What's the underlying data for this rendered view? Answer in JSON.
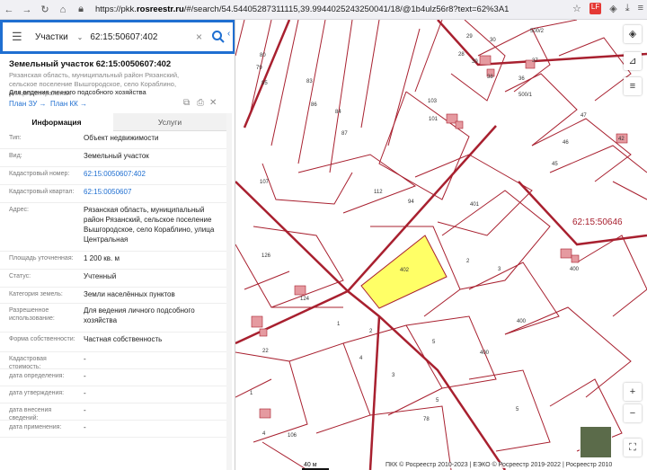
{
  "browser": {
    "url_prefix": "https://pkk.",
    "url_domain": "rosreestr.ru",
    "url_rest": "/#/search/54.54405287311115,39.9944025243250041/18/@1b4ulz56r8?text=62%3A1",
    "ext_badge": "LF"
  },
  "search": {
    "mode": "Участки",
    "query": "62:15:50607:402",
    "clear_symbol": "×"
  },
  "object": {
    "title": "Земельный участок 62:15:0050607:402",
    "address": "Рязанская область, муниципальный район Рязанский, сельское поселение Вышгородское, село Кораблино, улица Центральная",
    "purpose": "Для ведения личного подсобного хозяйства",
    "plan_zu": "План ЗУ →",
    "plan_kk": "План КК →"
  },
  "tabs": [
    "Информация",
    "Услуги"
  ],
  "rows": [
    {
      "k": "Тип:",
      "v": "Объект недвижимости"
    },
    {
      "k": "Вид:",
      "v": "Земельный участок"
    },
    {
      "k": "Кадастровый номер:",
      "v": "62:15:0050607:402"
    },
    {
      "k": "Кадастровый квартал:",
      "v": "62:15:0050607"
    },
    {
      "k": "Адрес:",
      "v": "Рязанская область, муниципальный район Рязанский, сельское поселение Вышгородское, село Кораблино, улица Центральная"
    },
    {
      "k": "Площадь уточненная:",
      "v": "1 200 кв. м"
    },
    {
      "k": "Статус:",
      "v": "Учтенный"
    },
    {
      "k": "Категория земель:",
      "v": "Земли населённых пунктов"
    },
    {
      "k": "Разрешенное использование:",
      "v": "Для ведения личного подсобного хозяйства"
    },
    {
      "k": "Форма собственности:",
      "v": "Частная собственность"
    },
    {
      "k": "Кадастровая стоимость:",
      "v": "-"
    },
    {
      "k": "дата определения:",
      "v": "-"
    },
    {
      "k": "дата утверждения:",
      "v": "-"
    },
    {
      "k": "дата внесения сведений:",
      "v": "-"
    },
    {
      "k": "дата применения:",
      "v": "-"
    }
  ],
  "map": {
    "labels": [
      "29",
      "28",
      "30",
      "500/2",
      "39",
      "38",
      "36",
      "37",
      "500/1",
      "80",
      "79",
      "85",
      "83",
      "86",
      "84",
      "103",
      "87",
      "101",
      "47",
      "46",
      "45",
      "42",
      "107",
      "112",
      "94",
      "401",
      "126",
      "402",
      "2",
      "3",
      "400",
      "124",
      "400",
      "1",
      "2",
      "5",
      "22",
      "4",
      "3",
      "400",
      "5",
      "1",
      "4",
      "78",
      "106",
      "5"
    ],
    "quarter_label": "62:15:50646",
    "scale": "40 м",
    "footer": "ПКК © Росреестр 2010-2023 | ЕЭКО © Росреестр 2019-2022 | Росреестр 2010"
  },
  "colors": {
    "accent": "#1f6fd1",
    "parcel_line": "#a8202f",
    "selected_fill": "#ffff66"
  }
}
